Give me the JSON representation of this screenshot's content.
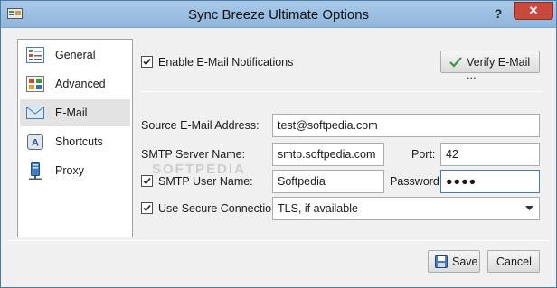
{
  "window": {
    "title": "Sync Breeze Ultimate Options",
    "help": "?",
    "close": "✕"
  },
  "sidebar": {
    "items": [
      {
        "label": "General"
      },
      {
        "label": "Advanced"
      },
      {
        "label": "E-Mail"
      },
      {
        "label": "Shortcuts"
      },
      {
        "label": "Proxy"
      }
    ]
  },
  "email": {
    "enable_label": "Enable E-Mail Notifications",
    "enable_checked": true,
    "verify_label": "Verify E-Mail ...",
    "source_label": "Source E-Mail Address:",
    "source_value": "test@softpedia.com",
    "smtp_server_label": "SMTP Server Name:",
    "smtp_server_value": "smtp.softpedia.com",
    "port_label": "Port:",
    "port_value": "42",
    "smtp_user_label": "SMTP User Name:",
    "smtp_user_checked": true,
    "smtp_user_value": "Softpedia",
    "password_label": "Password:",
    "password_value": "●●●●",
    "secure_label": "Use Secure Connection:",
    "secure_checked": true,
    "secure_value": "TLS, if available"
  },
  "footer": {
    "save_label": "Save",
    "cancel_label": "Cancel"
  },
  "watermark": "SOFTPEDIA",
  "colors": {
    "titlebar": "#a9c9e8",
    "close": "#c74a3d",
    "focus": "#3c7fb1",
    "selected": "#e3e3e3"
  }
}
